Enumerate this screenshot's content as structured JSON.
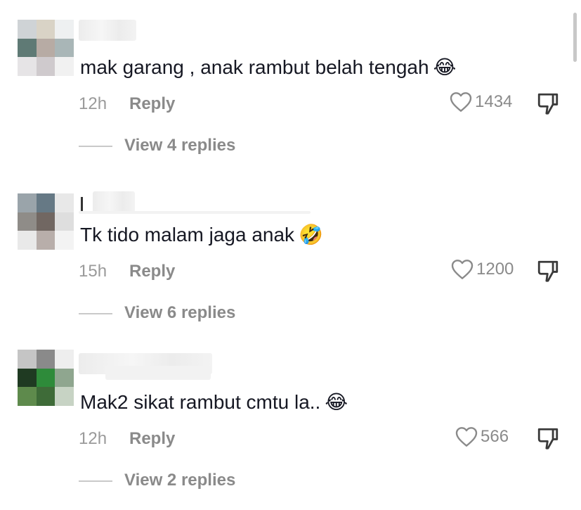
{
  "comments": [
    {
      "text": "mak garang , anak rambut belah tengah",
      "emoji_icon": "face-with-tears-of-joy",
      "emoji": "😂",
      "time": "12h",
      "reply_label": "Reply",
      "likes": "1434",
      "view_replies": "View 4 replies"
    },
    {
      "text": "Tk tido malam jaga anak",
      "emoji_icon": "rolling-on-floor-laughing",
      "emoji": "🤣",
      "time": "15h",
      "reply_label": "Reply",
      "likes": "1200",
      "view_replies": "View 6 replies"
    },
    {
      "text": "Mak2 sikat rambut cmtu la..",
      "emoji_icon": "face-with-tears-of-joy",
      "emoji": "😂",
      "time": "12h",
      "reply_label": "Reply",
      "likes": "566",
      "view_replies": "View 2 replies"
    }
  ],
  "icons": {
    "like": "heart-outline-icon",
    "dislike": "thumbs-down-outline-icon"
  },
  "colors": {
    "text": "#161823",
    "muted": "#8a8a8a",
    "background": "#ffffff"
  }
}
